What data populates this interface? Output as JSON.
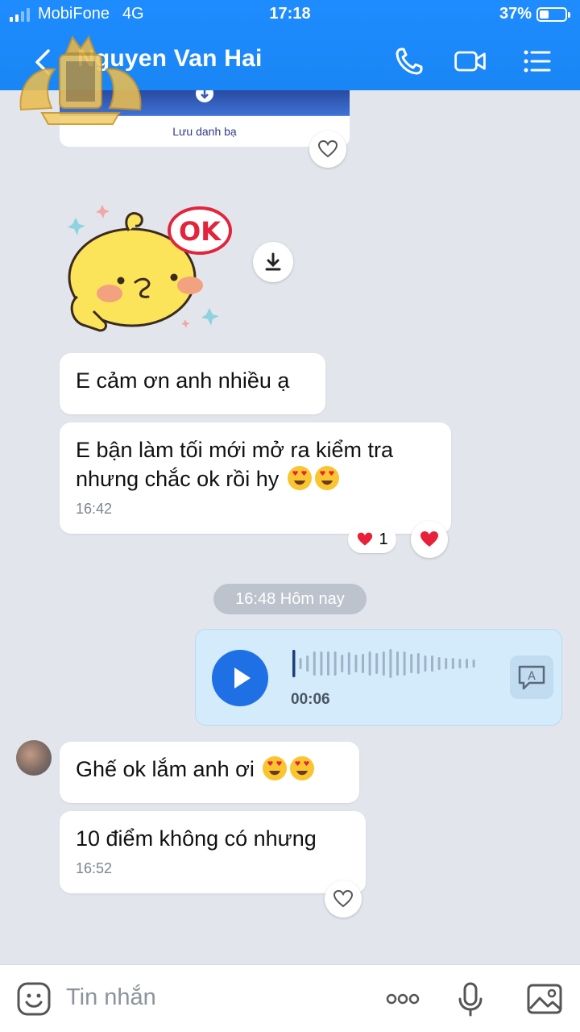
{
  "status_bar": {
    "carrier": "MobiFone",
    "network": "4G",
    "time": "17:18",
    "battery_percent": "37%",
    "battery_level": 0.37
  },
  "header": {
    "contact_name": "Nguyen Van Hai",
    "icons": [
      "back-icon",
      "phone-icon",
      "video-call-icon",
      "menu-icon"
    ]
  },
  "contact_card": {
    "save_label": "Lưu danh bạ"
  },
  "sticker": {
    "text": "OK"
  },
  "messages": [
    {
      "text": "E cảm ơn anh nhiều ạ"
    },
    {
      "text_line1": "E bận làm tối mới mở ra kiểm tra",
      "text_line2": "nhưng chắc ok rồi hy",
      "time": "16:42",
      "reaction_count": "1"
    },
    {
      "text": "Ghế ok lắm anh ơi"
    },
    {
      "text": "10 điểm không có nhưng",
      "time": "16:52"
    }
  ],
  "date_separator": "16:48 Hôm nay",
  "voice_message": {
    "duration": "00:06",
    "transcribe_letter": "A"
  },
  "composer": {
    "placeholder": "Tin nhắn",
    "icons": [
      "emoji-icon",
      "more-icon",
      "microphone-icon",
      "image-icon"
    ]
  },
  "colors": {
    "header_blue": "#1e8cff",
    "voice_bubble": "#d4ebfb",
    "play_button": "#1f6fe5",
    "heart_red": "#e8203a"
  }
}
